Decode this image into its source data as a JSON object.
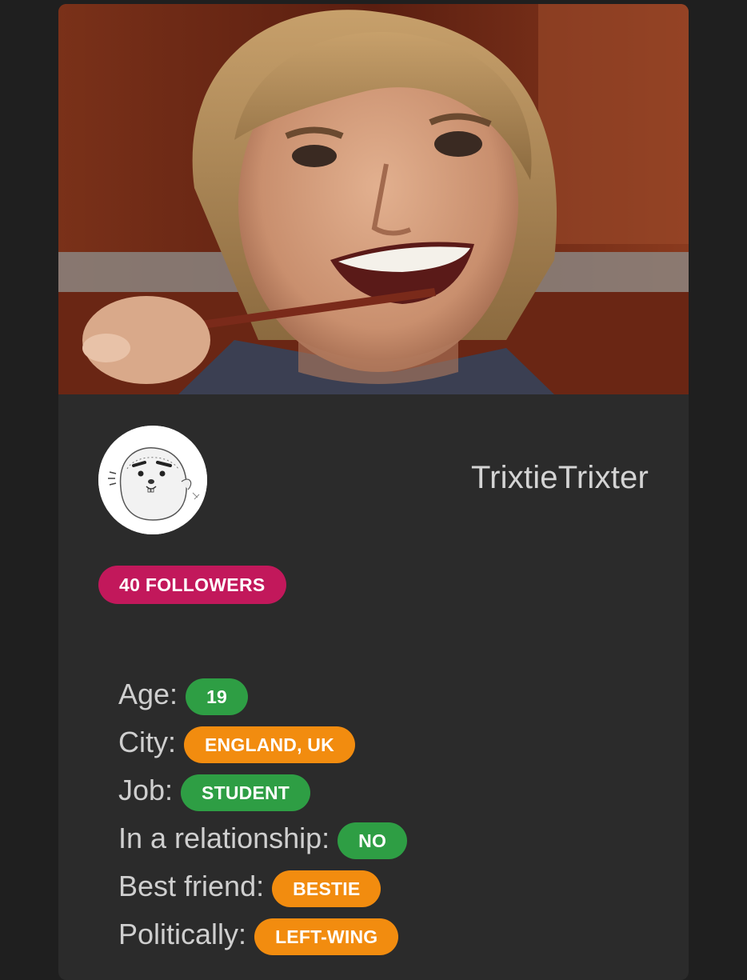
{
  "profile": {
    "username": "TrixtieTrixter",
    "followers_label": "40 FOLLOWERS",
    "cover_image": "photo of a smiling young man with shoulder-length blond hair holding a pencil in his teeth",
    "avatar_image": "hand-drawn white seal cartoon avatar"
  },
  "details": [
    {
      "label": "Age:",
      "value": "19",
      "color": "green"
    },
    {
      "label": "City:",
      "value": "ENGLAND, UK",
      "color": "orange"
    },
    {
      "label": "Job:",
      "value": "STUDENT",
      "color": "green"
    },
    {
      "label": "In a relationship:",
      "value": "NO",
      "color": "green"
    },
    {
      "label": "Best friend:",
      "value": "BESTIE",
      "color": "orange"
    },
    {
      "label": "Politically:",
      "value": "LEFT-WING",
      "color": "orange"
    }
  ],
  "colors": {
    "background": "#1f1f1f",
    "card": "#2b2b2b",
    "followers_badge": "#c2185b",
    "green_badge": "#2e9e44",
    "orange_badge": "#f28c0f"
  }
}
